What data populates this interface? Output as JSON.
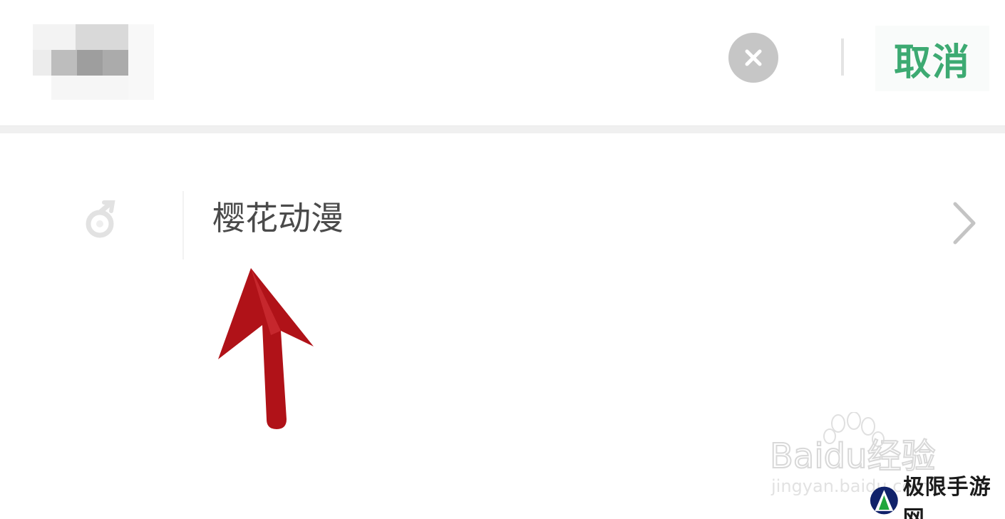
{
  "search_bar": {
    "query_text": "",
    "cancel_label": "取消",
    "clear_icon": "close-circle-icon"
  },
  "suggestions": [
    {
      "label": "樱花动漫",
      "icon": "app-icon",
      "trailing_icon": "chevron-right-icon"
    }
  ],
  "watermarks": {
    "baidu_logo_text": "Baidu经验",
    "baidu_url": "jingyan.baidu.com",
    "brand_name": "极限手游网"
  },
  "colors": {
    "accent": "#3daa72",
    "arrow": "#b01218",
    "clear_button": "#c6c6c6",
    "text": "#4a4a4a"
  }
}
